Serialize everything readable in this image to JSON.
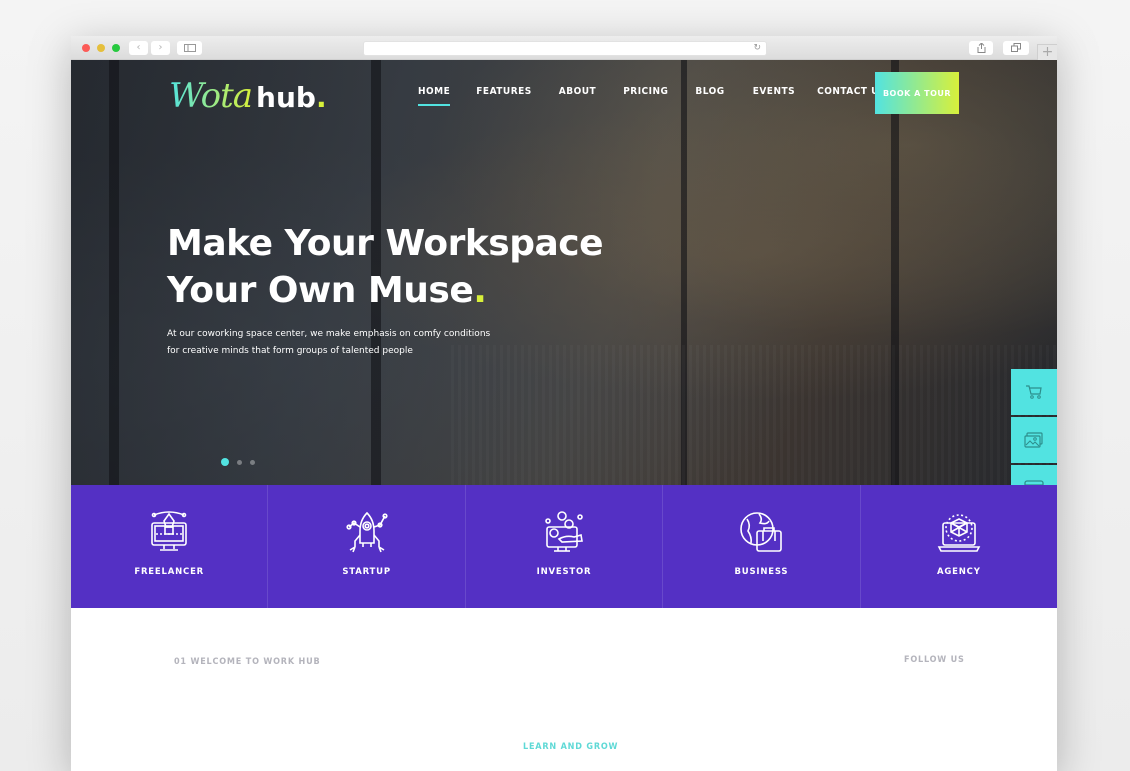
{
  "browser": {
    "window_controls": [
      "close",
      "minimize",
      "maximize"
    ],
    "back_icon": "‹",
    "forward_icon": "›",
    "reload_icon": "↻",
    "share_icon": "⇪",
    "tabs_icon": "⧉",
    "new_tab_icon": "+"
  },
  "brand": {
    "logo_script": "Wota",
    "logo_word": "hub",
    "logo_dot": ".",
    "accent_cyan": "#52e3e1",
    "accent_lime": "#d8f03a",
    "purple": "#5430c4"
  },
  "nav": {
    "items": [
      {
        "label": "HOME",
        "active": true
      },
      {
        "label": "FEATURES",
        "active": false
      },
      {
        "label": "ABOUT",
        "active": false
      },
      {
        "label": "PRICING",
        "active": false
      },
      {
        "label": "BLOG",
        "active": false
      },
      {
        "label": "EVENTS",
        "active": false
      },
      {
        "label": "CONTACT US",
        "active": false
      }
    ],
    "cta_label": "BOOK A TOUR"
  },
  "hero": {
    "title_line1": "Make Your Workspace",
    "title_line2": "Your Own Muse",
    "title_dot": ".",
    "subtitle_line1": "At our coworking space center, we make emphasis on comfy conditions",
    "subtitle_line2": "for creative minds that form groups of talented people",
    "slides_total": 3,
    "slide_active": 1
  },
  "side_tools": [
    {
      "icon": "cart-icon"
    },
    {
      "icon": "gallery-icon"
    },
    {
      "icon": "browser-window-icon"
    }
  ],
  "categories": [
    {
      "label": "FREELANCER",
      "icon": "pen-monitor-icon"
    },
    {
      "label": "STARTUP",
      "icon": "rocket-icon"
    },
    {
      "label": "INVESTOR",
      "icon": "coins-monitor-icon"
    },
    {
      "label": "BUSINESS",
      "icon": "globe-briefcase-icon"
    },
    {
      "label": "AGENCY",
      "icon": "cube-laptop-icon"
    }
  ],
  "sections": {
    "welcome": "01 WELCOME TO WORK HUB",
    "follow": "FOLLOW US",
    "learn": "LEARN AND GROW"
  }
}
